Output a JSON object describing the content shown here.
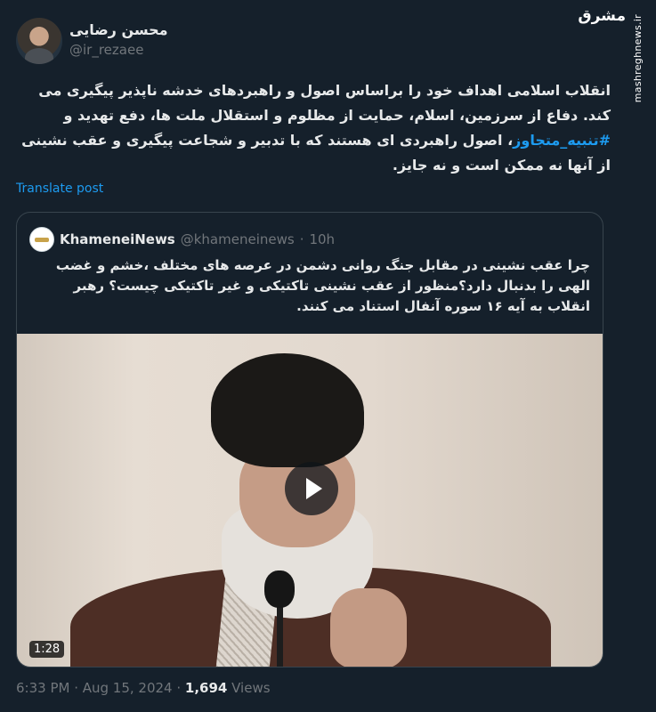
{
  "author": {
    "display_name": "محسن رضایی",
    "handle": "@ir_rezaee"
  },
  "watermark": {
    "logo": "مشرق",
    "url": "mashreghnews.ir"
  },
  "tweet": {
    "text_before_hashtag": "انقلاب اسلامی اهداف خود را براساس اصول و راهبردهای خدشه ناپذیر پیگیری می کند. دفاع از سرزمین، اسلام، حمایت از مظلوم و استقلال ملت ها، دفع تهدید و ",
    "hashtag": "#تنبیه_متجاوز",
    "text_after_hashtag": "، اصول راهبردی ای هستند که با تدبیر و شجاعت پیگیری و عقب نشینی از آنها نه ممکن است و نه جایز.",
    "translate_label": "Translate post"
  },
  "quoted": {
    "name": "KhameneiNews",
    "handle": "@khameneinews",
    "separator": "·",
    "time": "10h",
    "text": "چرا عقب نشینی در مقابل جنگ روانی دشمن در عرصه های مختلف ،خشم و غضب الهی را بدنبال دارد؟منظور از عقب نشینی تاکتیکی و غیر تاکتیکی چیست؟ رهبر انقلاب به آیه ۱۶ سوره آنفال استناد می کنند.",
    "video_duration": "1:28"
  },
  "meta": {
    "timestamp": "6:33 PM · Aug 15, 2024 · ",
    "views_count": "1,694",
    "views_label": " Views"
  },
  "colors": {
    "background": "#15202b",
    "accent": "#1d9bf0",
    "muted": "#71767b",
    "border": "#38444d"
  }
}
